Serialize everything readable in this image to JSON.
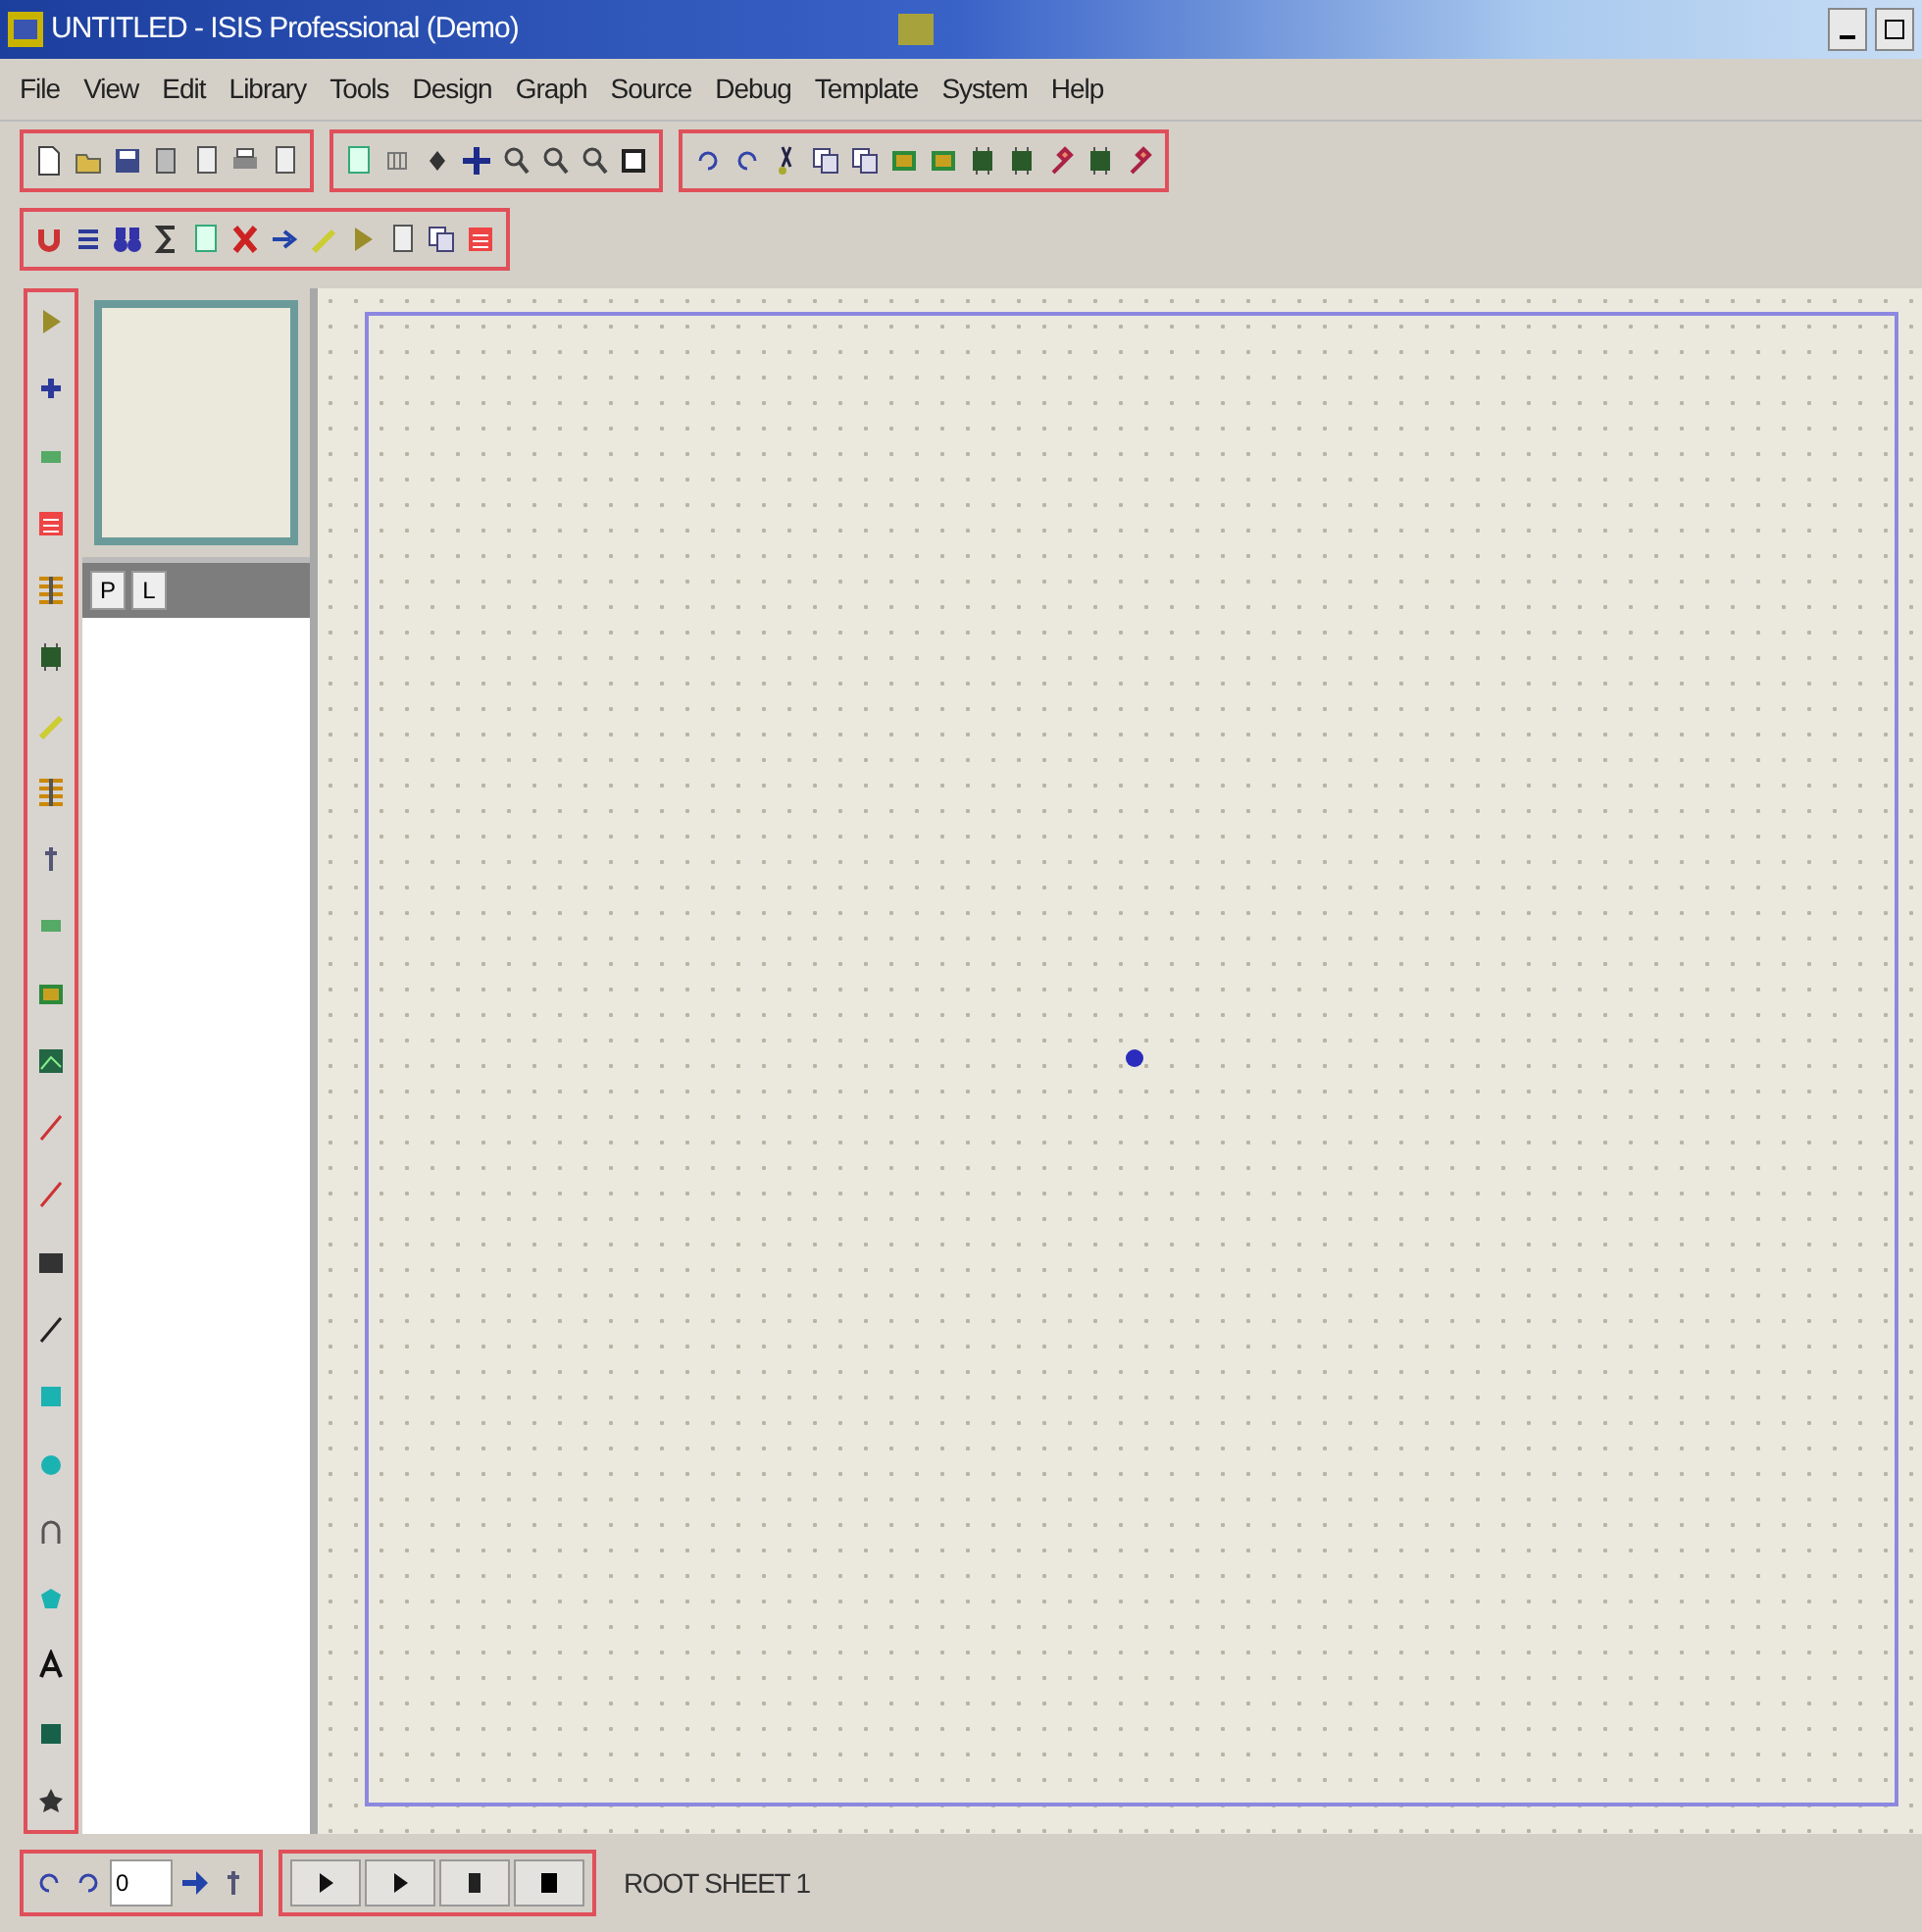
{
  "window": {
    "title": "UNTITLED - ISIS Professional (Demo)"
  },
  "menu": [
    "File",
    "View",
    "Edit",
    "Library",
    "Tools",
    "Design",
    "Graph",
    "Source",
    "Debug",
    "Template",
    "System",
    "Help"
  ],
  "device_selector": {
    "buttons": [
      "P",
      "L"
    ]
  },
  "rotation": {
    "angle": "0"
  },
  "status_bar": {
    "sheet": "ROOT SHEET 1"
  }
}
